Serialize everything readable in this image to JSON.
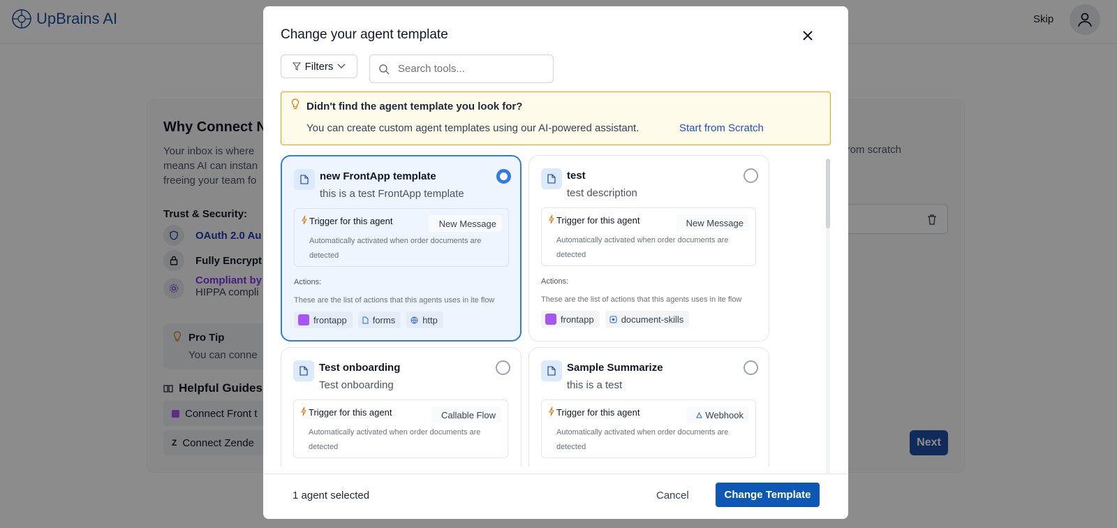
{
  "app": {
    "brand": "UpBrains AI",
    "skip_label": "Skip"
  },
  "background": {
    "title": "Why Connect N",
    "intro_lines": [
      "Your inbox is where",
      "means AI can instan",
      "freeing your team fo"
    ],
    "right_text": "d from scratch",
    "trust_title": "Trust & Security:",
    "trust_items": [
      {
        "title": "OAuth 2.0 Au",
        "sub": ""
      },
      {
        "title": "Fully Encrypt",
        "sub": ""
      },
      {
        "title": "Compliant by",
        "sub": "HIPPA compli"
      }
    ],
    "protip_title": "Pro Tip",
    "protip_text": "You can conne",
    "guides_title": "Helpful Guides",
    "guides": [
      "Connect Front t",
      "Connect Zende"
    ],
    "next_label": "Next"
  },
  "modal": {
    "title": "Change your agent template",
    "filters_label": "Filters",
    "search_placeholder": "Search tools...",
    "banner": {
      "title": "Didn't find the agent template you look for?",
      "text": "You can create custom agent templates using our AI-powered assistant.",
      "link": "Start from Scratch"
    },
    "trigger_label": "Trigger for this agent",
    "trigger_desc": "Automatically activated when order documents are detected",
    "actions_label": "Actions:",
    "actions_desc": "These are the list of actions that this agents uses in ite flow",
    "templates": [
      {
        "name": "new FrontApp template",
        "desc": "this is a test FrontApp template",
        "trigger": "New Message",
        "selected": true,
        "actions": [
          "frontapp",
          "forms",
          "http"
        ]
      },
      {
        "name": "test",
        "desc": "test description",
        "trigger": "New Message",
        "selected": false,
        "actions": [
          "frontapp",
          "document-skills"
        ]
      },
      {
        "name": "Test onboarding",
        "desc": "Test onboarding",
        "trigger": "Callable Flow",
        "selected": false,
        "actions": []
      },
      {
        "name": "Sample Summarize",
        "desc": "this is a test",
        "trigger": "Webhook",
        "selected": false,
        "actions": []
      }
    ],
    "footer": {
      "selected_count": "1 agent selected",
      "cancel_label": "Cancel",
      "change_label": "Change Template"
    }
  },
  "colors": {
    "accent": "#0d57b5",
    "selected_border": "#2f7be8",
    "banner_border": "#f59e0b",
    "banner_bg": "#fffbeb",
    "frontapp_icon": "#a855f7"
  }
}
